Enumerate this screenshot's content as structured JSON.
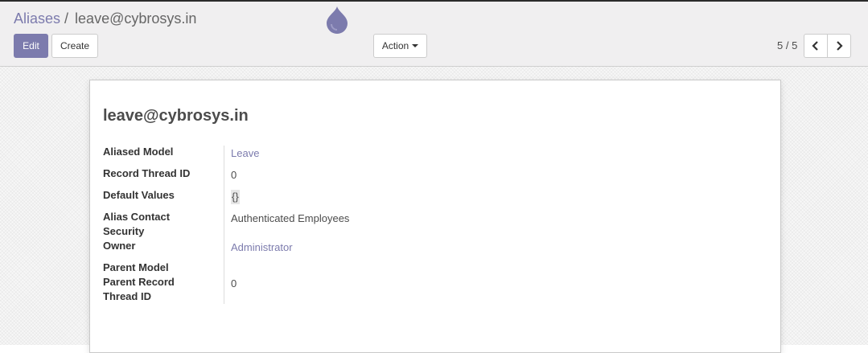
{
  "breadcrumb": {
    "parent": "Aliases",
    "separator": "/",
    "current": "leave@cybrosys.in"
  },
  "toolbar": {
    "edit_label": "Edit",
    "create_label": "Create",
    "action_label": "Action"
  },
  "pager": {
    "value": "5 / 5"
  },
  "icons": {
    "loader": "drop-icon",
    "prev": "chevron-left-icon",
    "next": "chevron-right-icon"
  },
  "colors": {
    "accent": "#7c7bad"
  },
  "record": {
    "title": "leave@cybrosys.in",
    "fields": {
      "aliased_model": {
        "label": "Aliased Model",
        "value": "Leave"
      },
      "record_thread_id": {
        "label": "Record Thread ID",
        "value": "0"
      },
      "default_values": {
        "label": "Default Values",
        "value": "{}"
      },
      "alias_contact_security": {
        "label": "Alias Contact Security",
        "value": "Authenticated Employees"
      },
      "owner": {
        "label": "Owner",
        "value": "Administrator"
      },
      "parent_model": {
        "label": "Parent Model",
        "value": ""
      },
      "parent_record_thread_id": {
        "label": "Parent Record Thread ID",
        "value": "0"
      }
    }
  }
}
